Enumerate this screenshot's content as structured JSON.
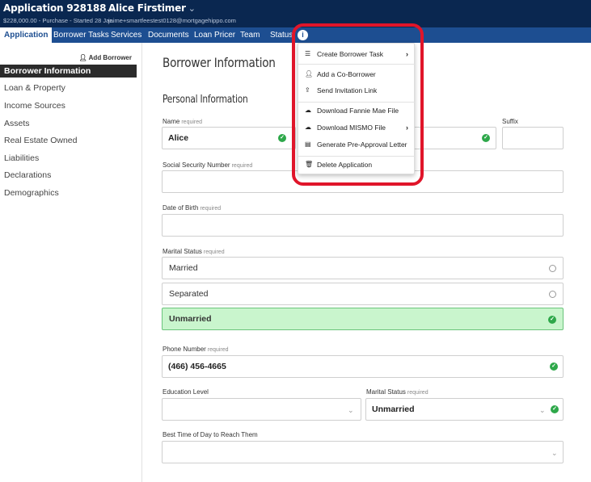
{
  "header": {
    "app_title": "Application 928188",
    "app_subtitle": "$228,000.00 - Purchase - Started 28 Jan",
    "user_name": "Alice Firstimer",
    "user_email": "jaime+smartfeestest0128@mortgagehippo.com"
  },
  "tabs": [
    "Application",
    "Borrower Tasks",
    "Services",
    "Documents",
    "Loan Pricer",
    "Team",
    "Status"
  ],
  "info_button": "i",
  "sidebar": {
    "add_borrower": "Add Borrower",
    "items": [
      "Borrower Information",
      "Loan & Property",
      "Income Sources",
      "Assets",
      "Real Estate Owned",
      "Liabilities",
      "Declarations",
      "Demographics"
    ]
  },
  "main": {
    "title": "Borrower Information",
    "section": "Personal Information",
    "required": "required",
    "name_label": "Name",
    "name_value": "Alice",
    "suffix_label": "Suffix",
    "ssn_label": "Social Security Number",
    "dob_label": "Date of Birth",
    "marital_label": "Marital Status",
    "marital_options": [
      "Married",
      "Separated",
      "Unmarried"
    ],
    "marital_selected": "Unmarried",
    "phone_label": "Phone Number",
    "phone_value": "(466) 456-4665",
    "education_label": "Education Level",
    "marital2_label": "Marital Status",
    "marital2_value": "Unmarried",
    "best_time_label": "Best Time of Day to Reach Them"
  },
  "menu": {
    "items": [
      {
        "label": "Create Borrower Task",
        "icon": "list-icon"
      },
      {
        "label": "Add a Co-Borrower",
        "icon": "user-plus-icon"
      },
      {
        "label": "Send Invitation Link",
        "icon": "share-icon"
      },
      {
        "label": "Download Fannie Mae File",
        "icon": "cloud-download-icon"
      },
      {
        "label": "Download MISMO File",
        "icon": "cloud-download-icon"
      },
      {
        "label": "Generate Pre-Approval Letter",
        "icon": "file-icon"
      },
      {
        "label": "Delete Application",
        "icon": "trash-icon"
      }
    ]
  },
  "colors": {
    "header_bg": "#0a2750",
    "tab_bg": "#1d4e91",
    "selected_option": "#c9f5cd",
    "check_green": "#2ea84a",
    "highlight": "#e0152a"
  }
}
